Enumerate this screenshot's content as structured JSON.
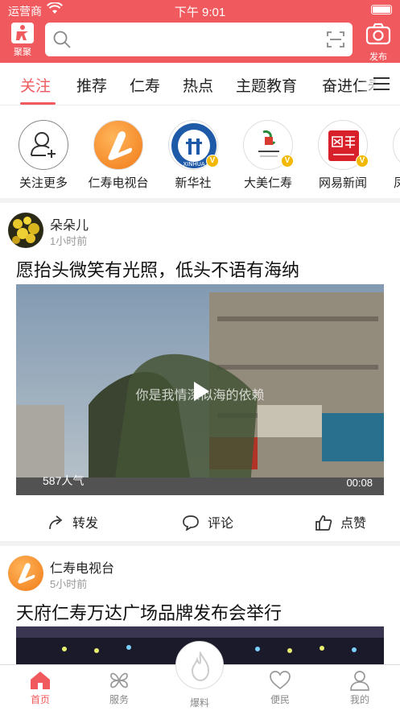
{
  "status_bar": {
    "carrier": "运营商",
    "time": "下午 9:01"
  },
  "header": {
    "logo_label": "聚聚",
    "search_placeholder": "",
    "publish_label": "发布"
  },
  "tabs": [
    {
      "label": "关注",
      "active": true
    },
    {
      "label": "推荐",
      "active": false
    },
    {
      "label": "仁寿",
      "active": false
    },
    {
      "label": "热点",
      "active": false
    },
    {
      "label": "主题教育",
      "active": false
    },
    {
      "label": "奋进仁寿",
      "active": false
    }
  ],
  "channels": [
    {
      "name": "关注更多",
      "icon": "add-user-icon",
      "verified": false
    },
    {
      "name": "仁寿电视台",
      "icon": "renshou-tv-logo",
      "verified": false
    },
    {
      "name": "新华社",
      "icon": "xinhua-logo",
      "verified": true
    },
    {
      "name": "大美仁寿",
      "icon": "damei-renshou-logo",
      "verified": true
    },
    {
      "name": "网易新闻",
      "icon": "netease-news-logo",
      "verified": true
    },
    {
      "name": "凤凰",
      "icon": "partial-logo",
      "verified": false
    }
  ],
  "posts": [
    {
      "author": "朵朵儿",
      "time": "1小时前",
      "title": "愿抬头微笑有光照，低头不语有海纳",
      "video_caption": "你是我情深似海的依赖",
      "views": "587人气",
      "duration": "00:08",
      "actions": {
        "share": "转发",
        "comment": "评论",
        "like": "点赞"
      }
    },
    {
      "author": "仁寿电视台",
      "time": "5小时前",
      "title": "天府仁寿万达广场品牌发布会举行"
    }
  ],
  "bottom_nav": [
    {
      "label": "首页",
      "icon": "home-icon",
      "active": true
    },
    {
      "label": "服务",
      "icon": "services-icon",
      "active": false
    },
    {
      "label": "爆料",
      "icon": "fire-icon",
      "active": false
    },
    {
      "label": "便民",
      "icon": "heart-icon",
      "active": false
    },
    {
      "label": "我的",
      "icon": "user-icon",
      "active": false
    }
  ],
  "colors": {
    "brand": "#f05a5e",
    "verified_badge": "#f3b800"
  }
}
